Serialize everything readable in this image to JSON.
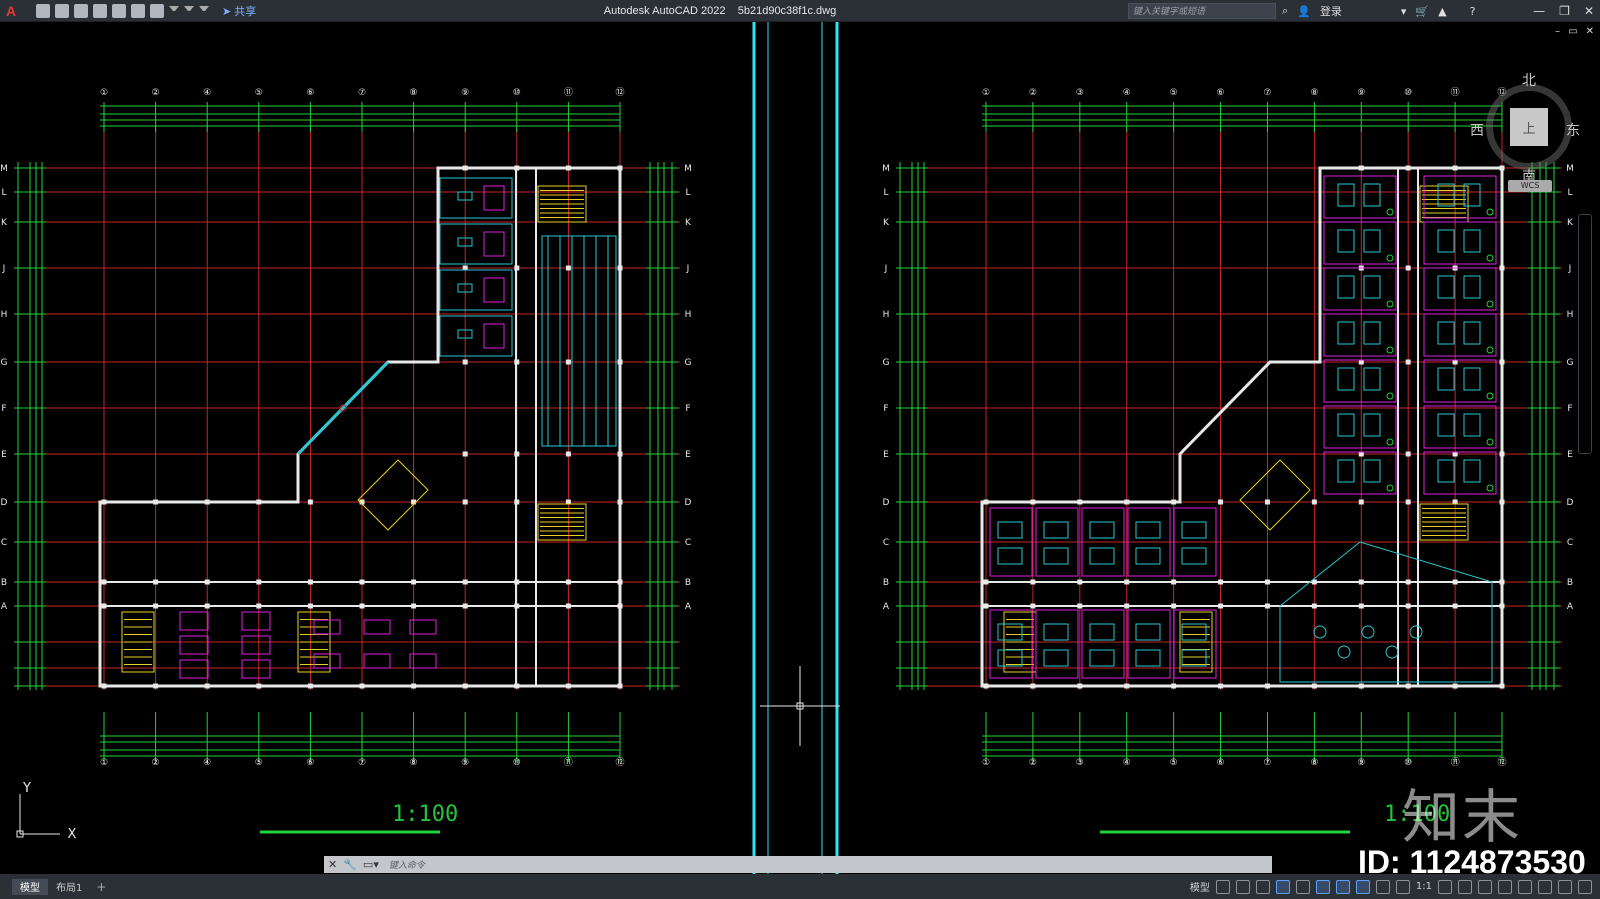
{
  "titlebar": {
    "app_letter": "A",
    "share_label": "共享",
    "app_name": "Autodesk AutoCAD 2022",
    "file_name": "5b21d90c38f1c.dwg",
    "search_placeholder": "键入关键字或短语",
    "login_label": "登录",
    "window_controls": [
      "—",
      "❐",
      "✕"
    ],
    "doc_controls": [
      "–",
      "▭",
      "✕"
    ]
  },
  "viewcube": {
    "north": "北",
    "south": "南",
    "east": "东",
    "west": "西",
    "face": "上",
    "wcs": "WCS"
  },
  "drawing": {
    "scale_left": "1:100",
    "scale_right": "1:100",
    "ucs_x": "X",
    "ucs_y": "Y",
    "colors": {
      "grid_red": "#c8262a",
      "dim_green": "#22d23a",
      "wall_white": "#e8e8e8",
      "wall_cyan": "#29c8d4",
      "furniture_magenta": "#e020e0",
      "stair_yellow": "#e8d020",
      "divider_cyan": "#2ee6f0"
    },
    "column_labels_left": [
      "①",
      "②",
      "④",
      "⑤",
      "⑥",
      "⑦",
      "⑧",
      "⑨",
      "⑩",
      "⑪",
      "⑫"
    ],
    "column_labels_right": [
      "①",
      "②",
      "③",
      "④",
      "⑤",
      "⑥",
      "⑦",
      "⑧",
      "⑨",
      "⑩",
      "⑪",
      "⑫"
    ],
    "row_labels": [
      "M",
      "L",
      "K",
      "J",
      "H",
      "G",
      "F",
      "E",
      "D",
      "C",
      "B",
      "A"
    ]
  },
  "watermark": {
    "logo": "知末",
    "id": "ID: 1124873530"
  },
  "cmdline": {
    "placeholder": "键入命令"
  },
  "statusbar": {
    "tabs": [
      "模型",
      "布局1"
    ],
    "add": "+",
    "model_label": "模型",
    "scale_label": "1:1"
  }
}
